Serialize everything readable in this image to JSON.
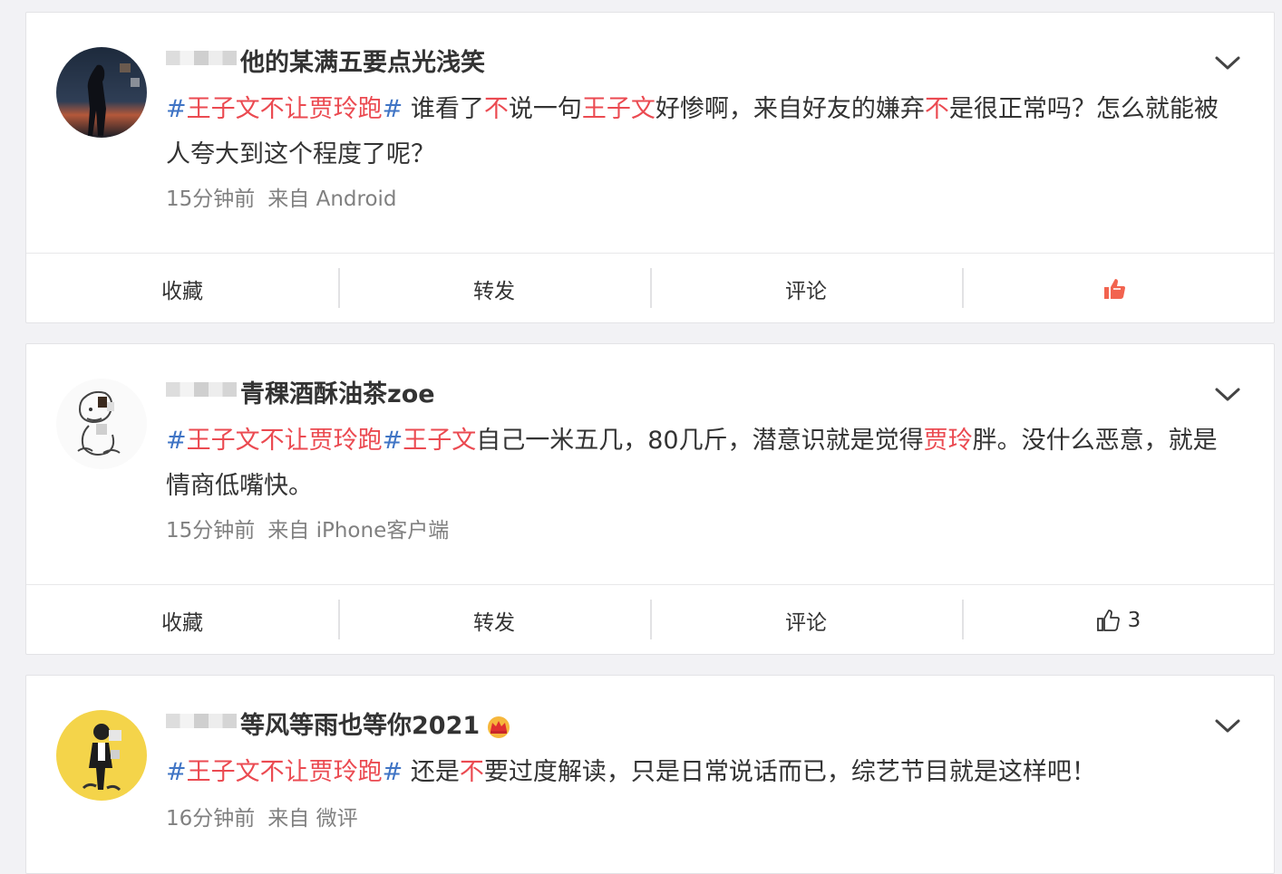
{
  "posts": [
    {
      "username": "他的某满五要点光浅笑",
      "content": [
        {
          "t": "#",
          "c": "hash"
        },
        {
          "t": "王子文不让贾玲跑",
          "c": "tag"
        },
        {
          "t": "#",
          "c": "hash"
        },
        {
          "t": " 谁看了",
          "c": ""
        },
        {
          "t": "不",
          "c": "hl"
        },
        {
          "t": "说一句",
          "c": ""
        },
        {
          "t": "王子文",
          "c": "hl"
        },
        {
          "t": "好惨啊，来自好友的嫌弃",
          "c": ""
        },
        {
          "t": "不",
          "c": "hl"
        },
        {
          "t": "是很正常吗？怎么就能被人夸大到这个程度了呢？",
          "c": ""
        }
      ],
      "time": "15分钟前",
      "source": "来自 Android",
      "actions": {
        "favorite": "收藏",
        "repost": "转发",
        "comment": "评论",
        "like_count": ""
      },
      "liked": true,
      "avatar_icon": "avatar-photo-silhouette"
    },
    {
      "username": "青稞酒酥油茶zoe",
      "content": [
        {
          "t": "#",
          "c": "hash"
        },
        {
          "t": "王子文不让贾玲跑",
          "c": "tag"
        },
        {
          "t": "#",
          "c": "hash"
        },
        {
          "t": "王子文",
          "c": "tag"
        },
        {
          "t": "自己一米五几，80几斤，潜意识就是觉得",
          "c": ""
        },
        {
          "t": "贾玲",
          "c": "hl"
        },
        {
          "t": "胖。没什么恶意，就是情商低嘴快。",
          "c": ""
        }
      ],
      "time": "15分钟前",
      "source": "来自 iPhone客户端",
      "actions": {
        "favorite": "收藏",
        "repost": "转发",
        "comment": "评论",
        "like_count": "3"
      },
      "liked": false,
      "avatar_icon": "avatar-cartoon-sketch"
    },
    {
      "username": "等风等雨也等你2021",
      "content": [
        {
          "t": "#",
          "c": "hash"
        },
        {
          "t": "王子文不让贾玲跑",
          "c": "tag"
        },
        {
          "t": "#",
          "c": "hash"
        },
        {
          "t": " 还是",
          "c": ""
        },
        {
          "t": "不",
          "c": "hl"
        },
        {
          "t": "要过度解读，只是日常说话而已，综艺节目就是这样吧！",
          "c": ""
        }
      ],
      "time": "16分钟前",
      "source": "来自 微评",
      "actions": {
        "favorite": "收藏",
        "repost": "转发",
        "comment": "评论",
        "like_count": ""
      },
      "liked": false,
      "avatar_icon": "avatar-yellow-figure",
      "badge_icon": "crown-icon"
    }
  ],
  "colors": {
    "highlight_red": "#eb4a51",
    "hash_blue": "#3f74c5",
    "like_orange": "#f2634f",
    "background": "#f2f2f5"
  }
}
